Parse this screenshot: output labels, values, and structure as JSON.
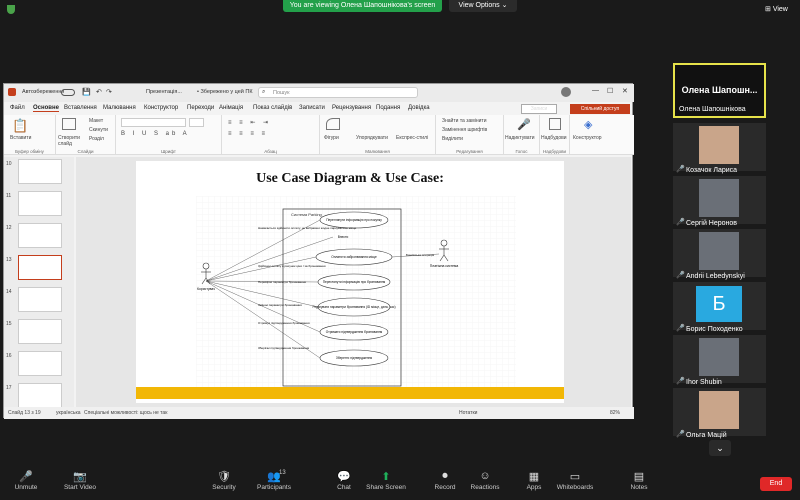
{
  "zoom": {
    "banner": "You are viewing Олена Шапошнікова's screen",
    "view_options": "View Options",
    "view": "View"
  },
  "ppt": {
    "autosave": "Автозбереження",
    "filename": "Презентація...",
    "saved": "• Збережено у цей ПК",
    "search_placeholder": "Пошук",
    "notes_btn": "Записи",
    "share_btn": "Спільний доступ",
    "tabs": [
      "Файл",
      "Основне",
      "Вставлення",
      "Малювання",
      "Конструктор",
      "Переходи",
      "Анімація",
      "Показ слайдів",
      "Записати",
      "Рецензування",
      "Подання",
      "Довідка"
    ],
    "groups": [
      {
        "label": "Буфер обміну",
        "btn": "Вставити"
      },
      {
        "label": "Слайди",
        "btn": "Створити слайд"
      },
      {
        "label": "Шрифт",
        "btn": ""
      },
      {
        "label": "Абзац",
        "btn": ""
      },
      {
        "label": "Малювання",
        "btn": "Фігури"
      },
      {
        "label": "Редагування",
        "btn": "Знайти"
      },
      {
        "label": "Голос",
        "btn": "Надиктувати"
      },
      {
        "label": "Надбудови",
        "btn": "Надбудови"
      },
      {
        "label": "",
        "btn": "Конструктор"
      }
    ],
    "slide_menu": [
      "Макет",
      "Скинути",
      "Розділ"
    ],
    "drawing_menu": [
      "Упорядкувати",
      "Експрес-стилі"
    ],
    "editing_menu": [
      "Знайти та замінити",
      "Замінення шрифтів",
      "Виділити"
    ],
    "thumb_nums": [
      "10",
      "11",
      "12",
      "13",
      "14",
      "15",
      "16",
      "17"
    ],
    "status_slide": "Слайд 13 з 19",
    "status_lang": "українська",
    "status_access": "Спеціальні можливості: щось не так",
    "status_notes": "Нотатки",
    "zoom": "82%"
  },
  "slide": {
    "title": "Use Case Diagram  & Use Case:",
    "system": "Система Parking",
    "actor_user": "Користувач",
    "actor_pay": "Платіжна система",
    "uc": [
      "Переглянути інформацію про покупку",
      "Внести",
      "Оплатити забронювання місце",
      "Переглянути інформацію про бронювання",
      "Редагувати параметри бронювання (ID місце, дата, час)",
      "Отримати підтвердження бронювання",
      "Зберегти підтвердження"
    ],
    "notes": [
      "Намагається здійснити оплату, не вибравши жодне паркувальне місце",
      "Здійснює оплату в рахунок ціни / за бронювання",
      "Перевіряє параметри бронювання",
      "Змінює параметри бронювання",
      "Отримує підтвердження бронювання",
      "Зберігає підтвердження бронювання",
      "Банківська операція"
    ]
  },
  "participants": [
    {
      "name": "Олена Шапошнікова",
      "tile_text": "Олена  Шапошн...",
      "avatar": "none"
    },
    {
      "name": "Козачок Лариса",
      "avatar": "photo-woman"
    },
    {
      "name": "Сергій Неронов",
      "avatar": "photo-man-glasses"
    },
    {
      "name": "Andrii Lebedynskyi",
      "avatar": "photo-man"
    },
    {
      "name": "Борис Походенко",
      "avatar": "letter",
      "letter": "Б",
      "color": "#29a9e0"
    },
    {
      "name": "Ihor Shubin",
      "avatar": "photo-man"
    },
    {
      "name": "Ольга Мацій",
      "avatar": "photo-woman"
    }
  ],
  "toolbar": [
    {
      "label": "Unmute",
      "icon": "mic-muted-icon"
    },
    {
      "label": "Start Video",
      "icon": "video-off-icon"
    },
    {
      "label": "Security",
      "icon": "shield-icon"
    },
    {
      "label": "Participants",
      "icon": "participants-icon",
      "count": "13"
    },
    {
      "label": "Chat",
      "icon": "chat-icon"
    },
    {
      "label": "Share Screen",
      "icon": "share-icon"
    },
    {
      "label": "Record",
      "icon": "record-icon"
    },
    {
      "label": "Reactions",
      "icon": "reactions-icon"
    },
    {
      "label": "Apps",
      "icon": "apps-icon"
    },
    {
      "label": "Whiteboards",
      "icon": "whiteboard-icon"
    },
    {
      "label": "Notes",
      "icon": "notes-icon"
    }
  ],
  "end": "End"
}
